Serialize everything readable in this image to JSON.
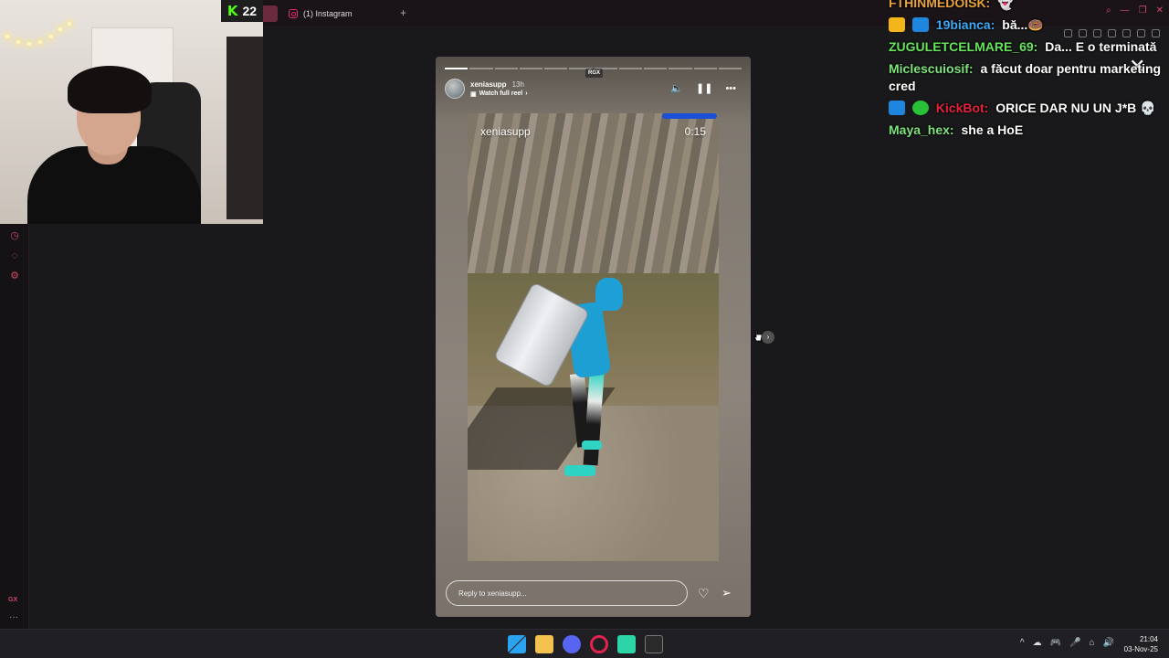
{
  "browser": {
    "tab_title": "(1) Instagram",
    "new_tab": "+",
    "window_controls": [
      "⌕",
      "—",
      "❐",
      "✕"
    ]
  },
  "webcam": {
    "viewer_count": "22",
    "platform_logo": "K"
  },
  "sidebar": {
    "icons": [
      "clock-icon",
      "messenger-icon",
      "settings-icon"
    ],
    "gx_label": "GX",
    "more_label": "···"
  },
  "story": {
    "badge": "RGX",
    "username": "xeniasupp",
    "time_ago": "13h",
    "subtitle": "Watch full reel",
    "subtitle_chevron": "›",
    "progress_segments": 12,
    "progress_done": 1,
    "reel_username": "xeniasupp",
    "reel_time": "0:15",
    "reply_placeholder": "Reply to xeniasupp...",
    "icons": {
      "mute": "🔈",
      "pause": "❚❚",
      "more": "•••",
      "heart": "♡",
      "send": "➢"
    },
    "next_glyph": "›"
  },
  "overlay": {
    "close": "✕"
  },
  "chat": {
    "messages": [
      {
        "user": "FTHINMEDOISK:",
        "user_color": "#e8a33b",
        "text": "👻",
        "badges": []
      },
      {
        "user": "19bianca:",
        "user_color": "#3fa9f5",
        "text": "bă...🍩",
        "badges": [
          "crown",
          "blue"
        ]
      },
      {
        "user": "ZUGULETCELMARE_69:",
        "user_color": "#66e55a",
        "text": "Da... E o terminată",
        "badges": []
      },
      {
        "user": "Miclescuiosif:",
        "user_color": "#7ee37a",
        "text": "a făcut doar pentru marketing cred",
        "badges": []
      },
      {
        "user": "KickBot:",
        "user_color": "#e5243b",
        "text": "ORICE DAR NU UN J*B 💀",
        "badges": [
          "blue",
          "verified"
        ]
      },
      {
        "user": "Maya_hex:",
        "user_color": "#7ee37a",
        "text": "she a HoE",
        "badges": []
      }
    ]
  },
  "taskbar": {
    "time": "21:04",
    "date": "03-Nov-25",
    "tray": [
      "^",
      "☁",
      "🎮",
      "🎤",
      "⌂",
      "🔊"
    ],
    "apps": [
      {
        "name": "windows-start",
        "color": "#2aa3f0"
      },
      {
        "name": "file-explorer",
        "color": "#f2c14e"
      },
      {
        "name": "discord",
        "color": "#5865f2"
      },
      {
        "name": "opera-gx",
        "color": "#e1234c"
      },
      {
        "name": "app-green",
        "color": "#2dd4a7"
      },
      {
        "name": "epic-games",
        "color": "#2a2a2a"
      }
    ]
  }
}
